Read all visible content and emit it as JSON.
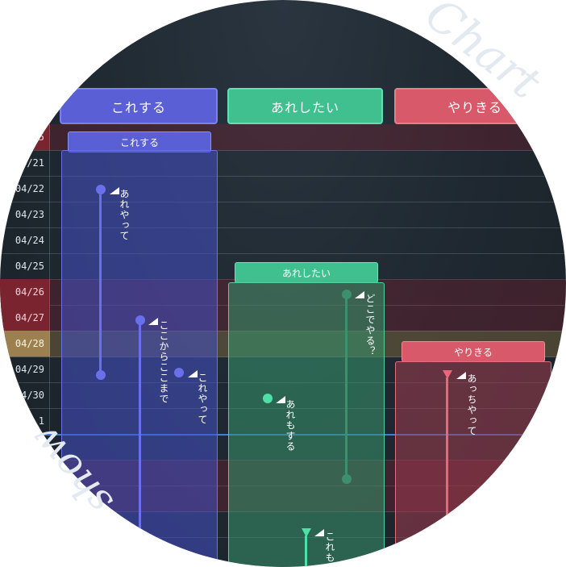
{
  "columns": [
    {
      "label": "これする"
    },
    {
      "label": "あれしたい"
    },
    {
      "label": "やりきる"
    }
  ],
  "dates": {
    "top_partial": "5",
    "d2": "4/21",
    "d3": "04/22",
    "d4": "04/23",
    "d5": "04/24",
    "d6": "04/25",
    "d7": "04/26",
    "d8": "04/27",
    "d9": "04/28",
    "d10": "04/29",
    "d11": "4/30",
    "d12": "1"
  },
  "tasks": {
    "blue": {
      "label": "これする"
    },
    "green": {
      "label": "あれしたい"
    },
    "red": {
      "label": "やりきる"
    }
  },
  "milestones": {
    "m1": "あれやって",
    "m2": "ここからここまで",
    "m3": "これやって",
    "m4": "どこでやる？",
    "m5": "あれもする",
    "m6": "あっちやって",
    "m7": "これも"
  },
  "decor": {
    "chart": "Chart",
    "show": "show"
  },
  "colors": {
    "blue": "#5b5fd6",
    "green": "#3fc08e",
    "red": "#d85a6a",
    "holiday": "#7a2430",
    "today": "#9c8050"
  }
}
